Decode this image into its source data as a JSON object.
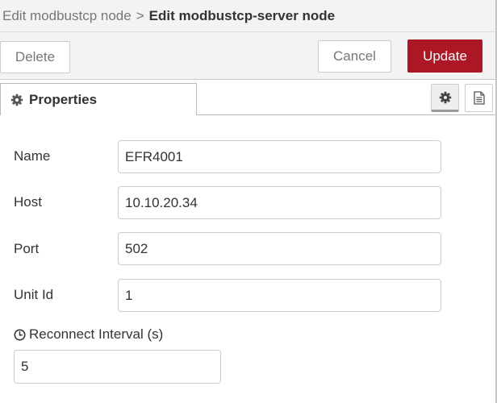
{
  "breadcrumb": {
    "parent": "Edit modbustcp node",
    "separator": ">",
    "current": "Edit modbustcp-server node"
  },
  "toolbar": {
    "delete_label": "Delete",
    "cancel_label": "Cancel",
    "update_label": "Update",
    "update_color": "#ad1625"
  },
  "tabs": {
    "properties_label": "Properties",
    "properties_icon": "gear-icon",
    "settings_icon": "gear-icon",
    "description_icon": "document-icon"
  },
  "form": {
    "name": {
      "label": "Name",
      "value": "EFR4001"
    },
    "host": {
      "label": "Host",
      "value": "10.10.20.34"
    },
    "port": {
      "label": "Port",
      "value": "502"
    },
    "unit_id": {
      "label": "Unit Id",
      "value": "1"
    },
    "reconnect": {
      "label": "Reconnect Interval (s)",
      "icon": "clock-icon",
      "value": "5"
    }
  }
}
